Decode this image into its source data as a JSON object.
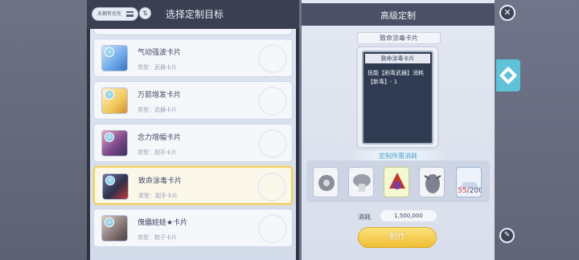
{
  "left": {
    "filter_label": "未拥有优先",
    "sort_icon": "sort-icon",
    "title": "选择定制目标",
    "cards": [
      {
        "name": "气动强波卡片",
        "type": "类型：武器卡片",
        "avatar_color": "#6aa8e8"
      },
      {
        "name": "万箭增发卡片",
        "type": "类型：武器卡片",
        "avatar_color": "#f0c85a"
      },
      {
        "name": "念力增幅卡片",
        "type": "类型：副手卡片",
        "avatar_color": "#7d4a8a"
      },
      {
        "name": "致命涂毒卡片",
        "type": "类型：副手卡片",
        "avatar_color": "#2e2f4a",
        "selected": true
      },
      {
        "name": "傀儡娃娃★卡片",
        "type": "类型：鞋子卡片",
        "avatar_color": "#8a7a7a"
      }
    ]
  },
  "right": {
    "title": "高级定制",
    "card_name": "致命涂毒卡片",
    "card_inner_title": "致命涂毒卡片",
    "card_desc": "技能【剧毒武器】消耗【新毒】- 1",
    "requirements_label": "定制所需消耗",
    "materials": [
      {
        "icon": "gear-material-icon"
      },
      {
        "icon": "mushroom-material-icon"
      },
      {
        "icon": "dragon-card-icon"
      },
      {
        "icon": "bug-material-icon"
      },
      {
        "icon": "ingot-material-icon"
      }
    ],
    "count_have": "55",
    "count_need": "/200",
    "cost_label": "消耗",
    "cost_value": "1,500,000",
    "make_button": "制作"
  },
  "side": {
    "close_icon": "close-icon",
    "tab_icon": "customize-tab-icon",
    "tool_icon": "wrench-icon"
  }
}
